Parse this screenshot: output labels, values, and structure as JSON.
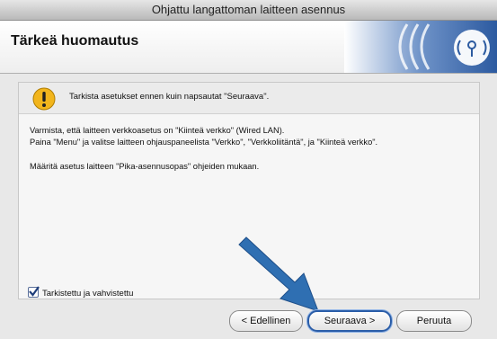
{
  "window": {
    "title": "Ohjattu langattoman laitteen asennus"
  },
  "header": {
    "title": "Tärkeä huomautus"
  },
  "notice": {
    "text": "Tarkista asetukset ennen kuin napsautat \"Seuraava\"."
  },
  "body": {
    "line1": "Varmista, että laitteen verkkoasetus on \"Kiinteä verkko\" (Wired LAN).",
    "line2": "Paina \"Menu\" ja valitse laitteen ohjauspaneelista \"Verkko\", \"Verkkoliitäntä\", ja \"Kiinteä verkko\".",
    "line3": "Määritä asetus laitteen \"Pika-asennusopas\" ohjeiden mukaan."
  },
  "confirm": {
    "label": "Tarkistettu ja vahvistettu",
    "checked": true
  },
  "buttons": {
    "back": "< Edellinen",
    "next": "Seuraava >",
    "cancel": "Peruuta"
  },
  "colors": {
    "accent": "#2a5da8",
    "arrow": "#2f6fb2",
    "warning": "#f2b51c"
  }
}
